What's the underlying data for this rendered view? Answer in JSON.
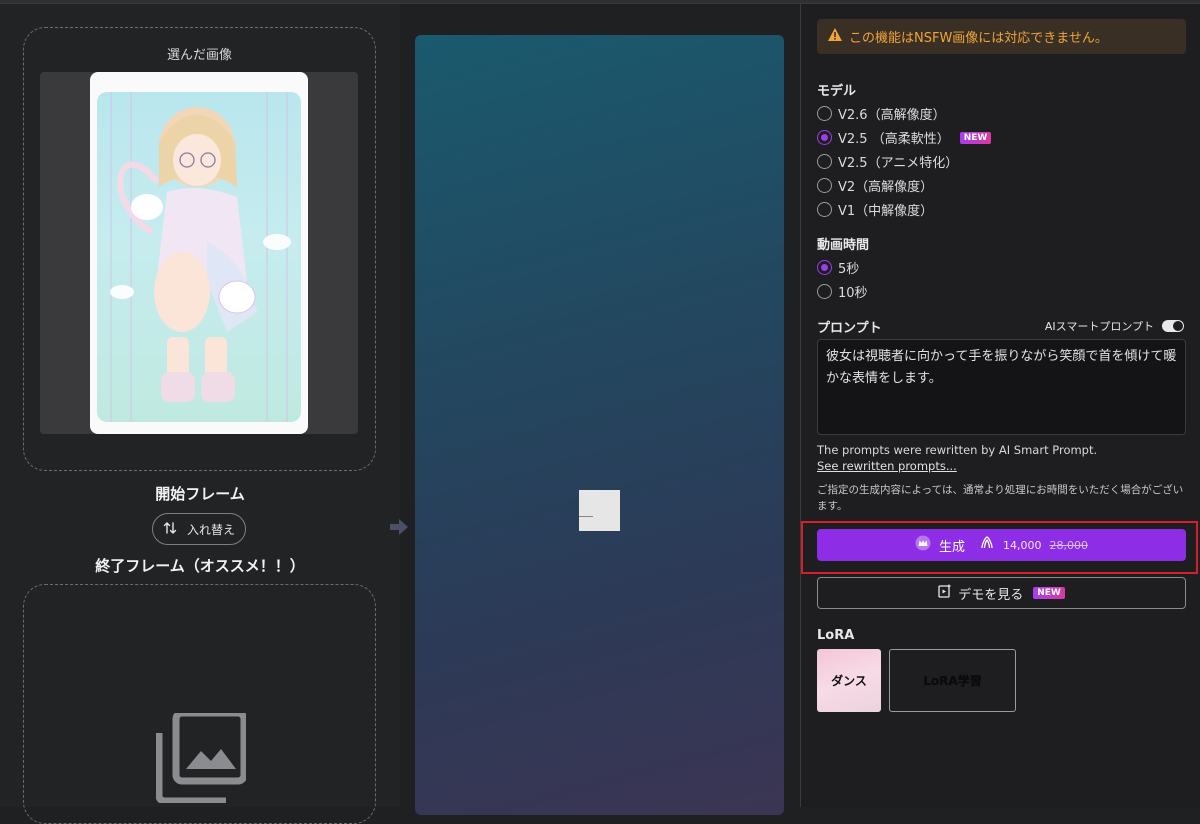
{
  "left": {
    "selected_image_label": "選んだ画像",
    "start_frame_label": "開始フレーム",
    "swap_button_label": "入れ替え",
    "end_frame_label": "終了フレーム（オススメ！！）"
  },
  "icons": {
    "swap": "swap-vertical-icon",
    "arrow": "arrow-right-icon",
    "gallery": "image-gallery-icon",
    "warning": "warning-icon",
    "crown": "crown-icon",
    "coins": "coins-icon",
    "demo": "video-demo-icon"
  },
  "right": {
    "warning_text": "この機能はNSFW画像には対応できません。",
    "model_title": "モデル",
    "models": [
      {
        "label": "V2.6（高解像度）",
        "checked": false,
        "new": false
      },
      {
        "label": "V2.5 （高柔軟性）",
        "checked": true,
        "new": true
      },
      {
        "label": "V2.5（アニメ特化）",
        "checked": false,
        "new": false
      },
      {
        "label": "V2（高解像度）",
        "checked": false,
        "new": false
      },
      {
        "label": "V1（中解像度）",
        "checked": false,
        "new": false
      }
    ],
    "new_badge": "NEW",
    "duration_title": "動画時間",
    "durations": [
      {
        "label": "5秒",
        "checked": true
      },
      {
        "label": "10秒",
        "checked": false
      }
    ],
    "prompt_title": "プロンプト",
    "ai_smart_prompt_label": "AIスマートプロンプト",
    "prompt_text": "彼女は視聴者に向かって手を振りながら笑顔で首を傾けて暖かな表情をします。",
    "rewritten_note": "The prompts were rewritten by AI Smart Prompt.",
    "rewritten_link": "See rewritten prompts...",
    "notice": "ご指定の生成内容によっては、通常より処理にお時間をいただく場合がございます。",
    "generate_label": "生成",
    "generate_cost": "14,000",
    "generate_cost_old": "28,000",
    "demo_label": "デモを見る",
    "demo_badge": "NEW",
    "lora_title": "LoRA",
    "lora_dance_label": "ダンス",
    "lora_train_label": "LoRA学習"
  },
  "colors": {
    "accent": "#8d2ee6",
    "warning": "#f0a53a",
    "highlight": "#d4202a"
  }
}
